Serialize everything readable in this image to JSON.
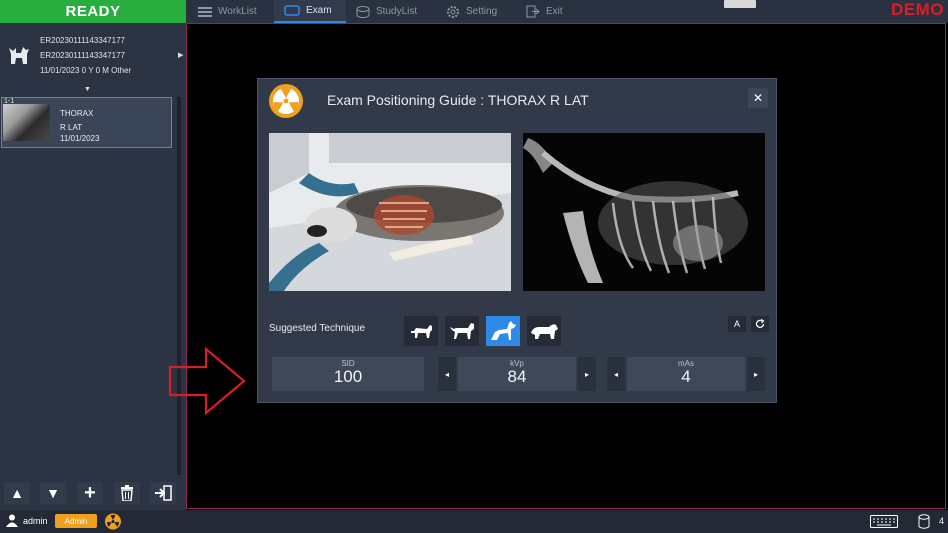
{
  "app": {
    "status": "READY",
    "mode_badge": "DEMO"
  },
  "nav": {
    "tabs": [
      {
        "label": "WorkList",
        "icon": "menu-icon"
      },
      {
        "label": "Exam",
        "icon": "exam-icon",
        "active": true
      },
      {
        "label": "StudyList",
        "icon": "database-icon"
      },
      {
        "label": "Setting",
        "icon": "gear-icon"
      },
      {
        "label": "Exit",
        "icon": "exit-icon"
      }
    ]
  },
  "patient": {
    "id": "ER20230111143347177",
    "accession": "ER20230111143347177",
    "details": "11/01/2023 0 Y 0 M Other"
  },
  "study_card": {
    "index": "1-1",
    "body_part": "THORAX",
    "view": "R LAT",
    "date": "11/01/2023"
  },
  "left_actions": [
    "up-icon",
    "down-icon",
    "add-icon",
    "trash-icon",
    "export-icon"
  ],
  "statusbar": {
    "user": "admin",
    "role": "Admin",
    "right_text": "4"
  },
  "dialog": {
    "title": "Exam Positioning Guide : THORAX R LAT",
    "close": "✕",
    "suggested_label": "Suggested Technique",
    "technique_sizes": [
      "small-dog-icon",
      "medium-dog-icon",
      "large-dog-icon",
      "giant-dog-icon"
    ],
    "selected_size_index": 2,
    "auto_label": "A",
    "reset_icon": "refresh-icon",
    "params": {
      "sid": {
        "label": "SID",
        "value": "100"
      },
      "kvp": {
        "label": "kVp",
        "value": "84"
      },
      "mas": {
        "label": "mAs",
        "value": "4"
      }
    },
    "step_down": "◂",
    "step_up": "▸"
  },
  "colors": {
    "ready": "#27ae3f",
    "accent": "#2e8ae6",
    "demo": "#e01b24",
    "arrow": "#d61f26",
    "admin_badge": "#f0a020"
  }
}
